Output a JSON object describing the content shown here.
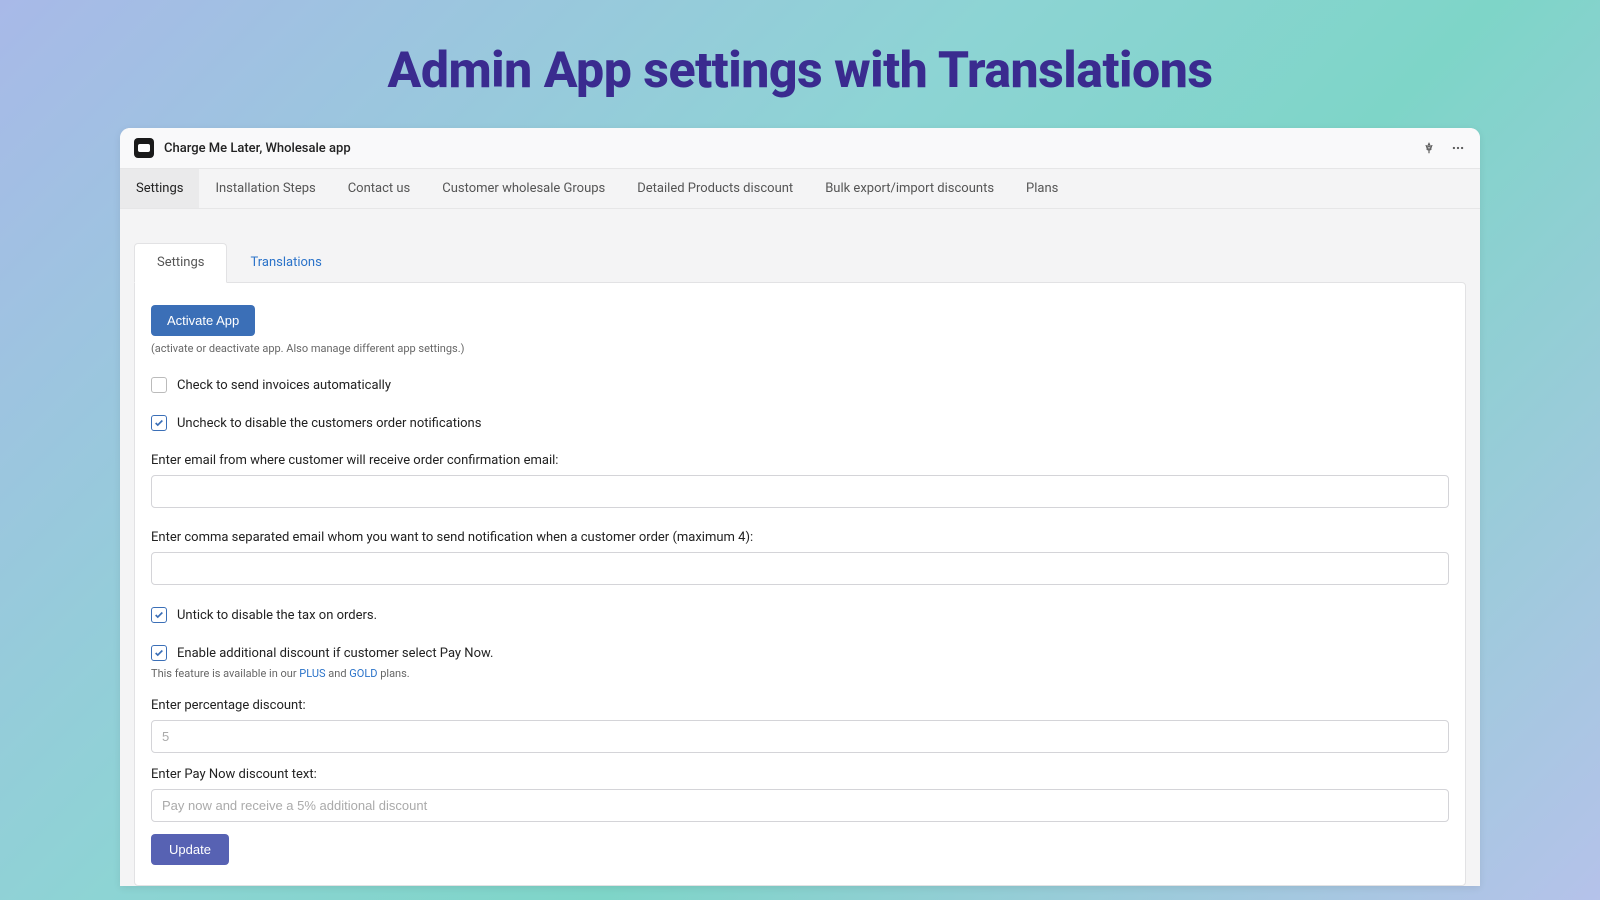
{
  "page_heading": "Admin App settings with Translations",
  "titlebar": {
    "app_name": "Charge Me Later, Wholesale app"
  },
  "main_tabs": [
    {
      "label": "Settings",
      "active": true
    },
    {
      "label": "Installation Steps"
    },
    {
      "label": "Contact us"
    },
    {
      "label": "Customer wholesale Groups"
    },
    {
      "label": "Detailed Products discount"
    },
    {
      "label": "Bulk export/import discounts"
    },
    {
      "label": "Plans"
    }
  ],
  "inner_tabs": [
    {
      "label": "Settings",
      "active": true
    },
    {
      "label": "Translations",
      "link": true
    }
  ],
  "settings": {
    "activate_btn": "Activate App",
    "activate_hint": "(activate or deactivate app. Also manage different app settings.)",
    "cb_invoices": {
      "label": "Check to send invoices automatically",
      "checked": false
    },
    "cb_notifications": {
      "label": "Uncheck to disable the customers order notifications",
      "checked": true
    },
    "email_from_label": "Enter email from where customer will receive order confirmation email:",
    "email_from_value": "",
    "notify_emails_label": "Enter comma separated email whom you want to send notification when a customer order (maximum 4):",
    "notify_emails_value": "",
    "cb_tax": {
      "label": "Untick to disable the tax on orders.",
      "checked": true
    },
    "cb_paynow": {
      "label": "Enable additional discount if customer select Pay Now.",
      "checked": true
    },
    "feature_note_pre": "This feature is available in our ",
    "feature_note_plus": "PLUS",
    "feature_note_and": " and ",
    "feature_note_gold": "GOLD",
    "feature_note_post": " plans.",
    "pct_label": "Enter percentage discount:",
    "pct_placeholder": "5",
    "paynow_text_label": "Enter Pay Now discount text:",
    "paynow_text_placeholder": "Pay now and receive a 5% additional discount",
    "update_btn": "Update"
  }
}
